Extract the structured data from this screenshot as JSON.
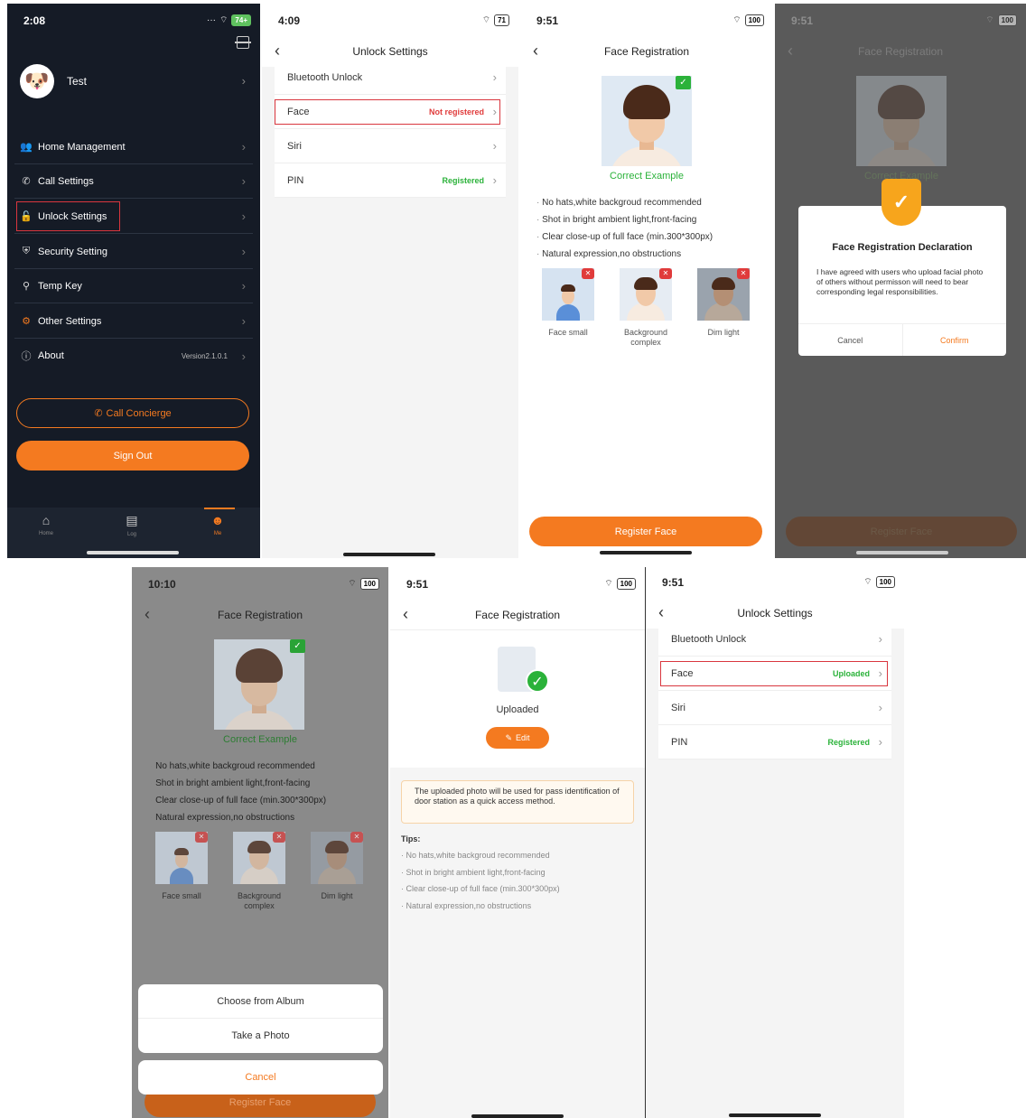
{
  "screen1": {
    "time": "2:08",
    "battery": "74+",
    "username": "Test",
    "menu": [
      {
        "label": "Home Management",
        "icon": "users-icon"
      },
      {
        "label": "Call Settings",
        "icon": "phone-icon"
      },
      {
        "label": "Unlock Settings",
        "icon": "lock-icon"
      },
      {
        "label": "Security Setting",
        "icon": "shield-icon"
      },
      {
        "label": "Temp Key",
        "icon": "key-icon"
      },
      {
        "label": "Other Settings",
        "icon": "gear-icon"
      },
      {
        "label": "About",
        "icon": "info-icon"
      }
    ],
    "version": "Version2.1.0.1",
    "call_concierge": "Call Concierge",
    "sign_out": "Sign Out",
    "tabs": [
      "Home",
      "Log",
      "Me"
    ],
    "accent": "#f47a20"
  },
  "screen2": {
    "time": "4:09",
    "battery": "71",
    "title": "Unlock Settings",
    "rows": [
      {
        "label": "Bluetooth Unlock",
        "value": ""
      },
      {
        "label": "Face",
        "value": "Not registered"
      },
      {
        "label": "Siri",
        "value": ""
      },
      {
        "label": "PIN",
        "value": "Registered"
      }
    ]
  },
  "face_common": {
    "title": "Face Registration",
    "correct_example": "Correct Example",
    "tips": [
      "No hats,white backgroud recommended",
      "Shot in bright ambient light,front-facing",
      "Clear close-up of full face (min.300*300px)",
      "Natural expression,no obstructions"
    ],
    "bad_examples": [
      "Face small",
      "Background complex",
      "Dim light"
    ],
    "register_button": "Register Face"
  },
  "screen3": {
    "time": "9:51",
    "battery": "100"
  },
  "screen4": {
    "time": "9:51",
    "battery": "100",
    "dialog_title": "Face Registration Declaration",
    "dialog_body": "I have agreed with users who upload facial photo of others without permisson will need to bear corresponding legal responsibilities.",
    "cancel": "Cancel",
    "confirm": "Confirm"
  },
  "screen5": {
    "time": "10:10",
    "battery": "100",
    "sheet": [
      "Choose from Album",
      "Take a Photo"
    ],
    "cancel": "Cancel"
  },
  "screen6": {
    "time": "9:51",
    "battery": "100",
    "uploaded": "Uploaded",
    "edit": "Edit",
    "notice": "The uploaded photo will be used for pass identification of door station as a quick access method.",
    "tips_label": "Tips:"
  },
  "screen7": {
    "time": "9:51",
    "battery": "100",
    "title": "Unlock Settings",
    "rows": [
      {
        "label": "Bluetooth Unlock",
        "value": ""
      },
      {
        "label": "Face",
        "value": "Uploaded"
      },
      {
        "label": "Siri",
        "value": ""
      },
      {
        "label": "PIN",
        "value": "Registered"
      }
    ]
  }
}
